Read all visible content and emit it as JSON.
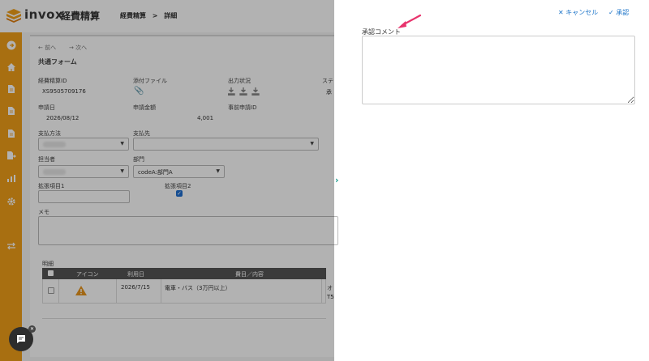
{
  "app": {
    "brand": "invox",
    "brand_sub": "経費精算",
    "breadcrumb": [
      "経費精算",
      ">",
      "詳細"
    ]
  },
  "sidebar_icons": [
    "arrow-right-circle-icon",
    "home-icon",
    "document-icon",
    "document-icon",
    "document-icon",
    "document-export-icon",
    "chart-icon",
    "gear-icon",
    "transfer-icon"
  ],
  "nav": {
    "prev": "前へ",
    "next": "次へ"
  },
  "form": {
    "title": "共通フォーム",
    "fields": {
      "expense_id_label": "経費精算ID",
      "expense_id_value": "XS9505709176",
      "attachment_label": "添付ファイル",
      "output_status_label": "出力状況",
      "status_label": "ステ",
      "status_value": "承",
      "apply_date_label": "申請日",
      "apply_date_value": "2026/08/12",
      "amount_label": "申請金額",
      "amount_value": "4,001",
      "pre_apply_label": "事前申請ID",
      "payment_method_label": "支払方法",
      "payee_label": "支払先",
      "person_label": "担当者",
      "department_label": "部門",
      "department_value": "codeA:部門A",
      "ext1_label": "拡張項目1",
      "ext2_label": "拡張項目2",
      "memo_label": "メモ"
    }
  },
  "details": {
    "title": "明細",
    "columns": [
      "アイコン",
      "利用日",
      "費目／内容"
    ],
    "rows": [
      {
        "date": "2026/7/15",
        "content": "電車・バス（3万円以上）",
        "extra1": "オ",
        "extra2": "T5"
      }
    ]
  },
  "panel": {
    "cancel_label": "キャンセル",
    "approve_label": "承認",
    "comment_label": "承認コメント"
  },
  "colors": {
    "sidebar": "#f19f19",
    "accent_blue": "#1a73c8",
    "expand_teal": "#1a9c8f",
    "warning": "#e8961e"
  }
}
